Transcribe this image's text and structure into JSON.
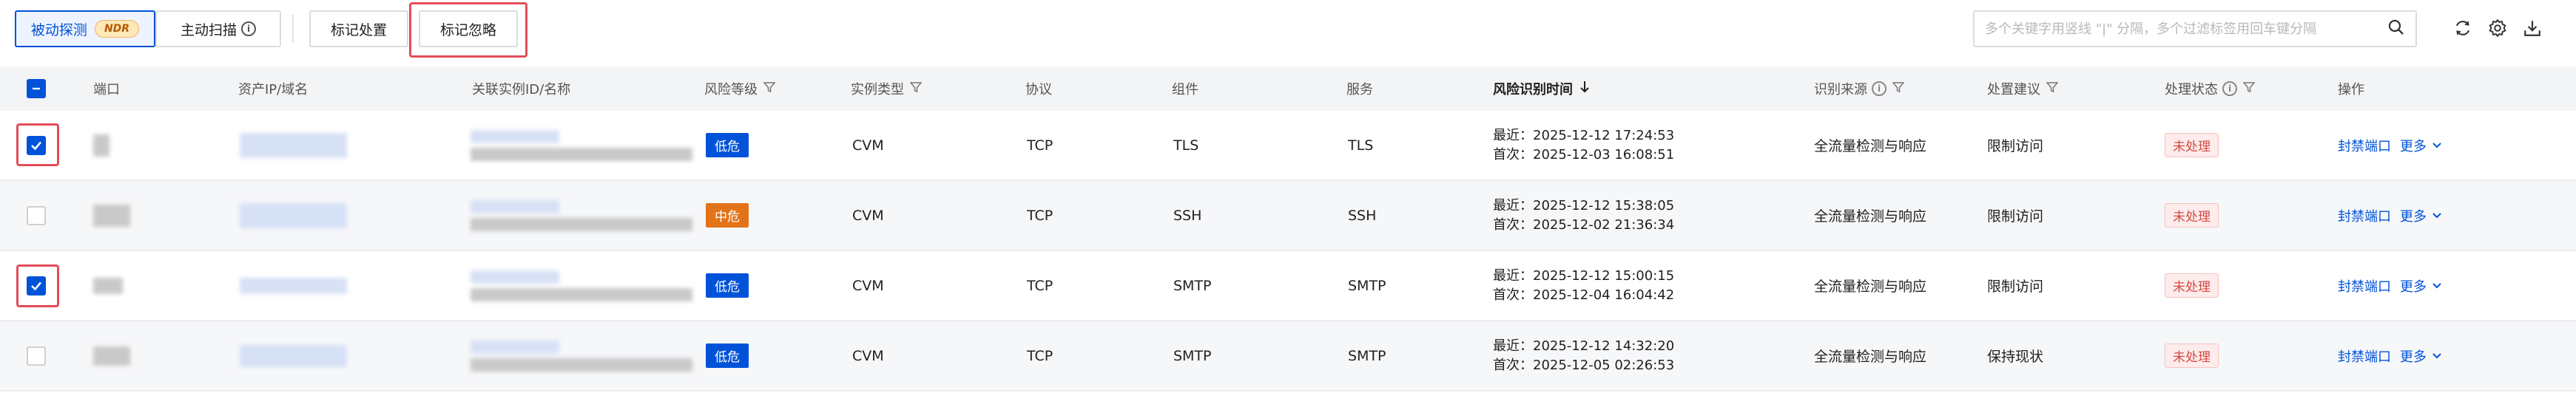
{
  "toolbar": {
    "tabs": [
      {
        "label": "被动探测",
        "badge": "NDR",
        "active": true
      },
      {
        "label": "主动扫描",
        "active": false
      }
    ],
    "actions": [
      {
        "label": "标记处置"
      },
      {
        "label": "标记忽略"
      }
    ],
    "search_placeholder": "多个关键字用竖线 \"|\" 分隔，多个过滤标签用回车键分隔",
    "icons": [
      "search-icon",
      "refresh-icon",
      "settings-icon",
      "download-icon"
    ]
  },
  "table": {
    "headers": {
      "port": "端口",
      "asset": "资产IP/域名",
      "instance": "关联实例ID/名称",
      "risk_level": "风险等级",
      "instance_type": "实例类型",
      "protocol": "协议",
      "component": "组件",
      "service": "服务",
      "identify_time": "风险识别时间",
      "source": "识别来源",
      "suggestion": "处置建议",
      "status": "处理状态",
      "ops": "操作"
    },
    "rows": [
      {
        "checked": true,
        "risk": "低危",
        "risk_level": "low",
        "instance_type": "CVM",
        "protocol": "TCP",
        "component": "TLS",
        "service": "TLS",
        "latest": "最近：2025-12-12 17:24:53",
        "first": "首次：2025-12-03 16:08:51",
        "source": "全流量检测与响应",
        "suggestion": "限制访问",
        "status": "未处理",
        "op_link": "封禁端口",
        "op_more": "更多"
      },
      {
        "checked": false,
        "risk": "中危",
        "risk_level": "mid",
        "instance_type": "CVM",
        "protocol": "TCP",
        "component": "SSH",
        "service": "SSH",
        "latest": "最近：2025-12-12 15:38:05",
        "first": "首次：2025-12-02 21:36:34",
        "source": "全流量检测与响应",
        "suggestion": "限制访问",
        "status": "未处理",
        "op_link": "封禁端口",
        "op_more": "更多"
      },
      {
        "checked": true,
        "risk": "低危",
        "risk_level": "low",
        "instance_type": "CVM",
        "protocol": "TCP",
        "component": "SMTP",
        "service": "SMTP",
        "latest": "最近：2025-12-12 15:00:15",
        "first": "首次：2025-12-04 16:04:42",
        "source": "全流量检测与响应",
        "suggestion": "限制访问",
        "status": "未处理",
        "op_link": "封禁端口",
        "op_more": "更多"
      },
      {
        "checked": false,
        "risk": "低危",
        "risk_level": "low",
        "instance_type": "CVM",
        "protocol": "TCP",
        "component": "SMTP",
        "service": "SMTP",
        "latest": "最近：2025-12-12 14:32:20",
        "first": "首次：2025-12-05 02:26:53",
        "source": "全流量检测与响应",
        "suggestion": "保持现状",
        "status": "未处理",
        "op_link": "封禁端口",
        "op_more": "更多"
      }
    ]
  },
  "colors": {
    "primary": "#0052d9",
    "low_risk": "#0052d9",
    "mid_risk": "#e37318",
    "status_red": "#d54941",
    "highlight_red": "#e34d59"
  }
}
